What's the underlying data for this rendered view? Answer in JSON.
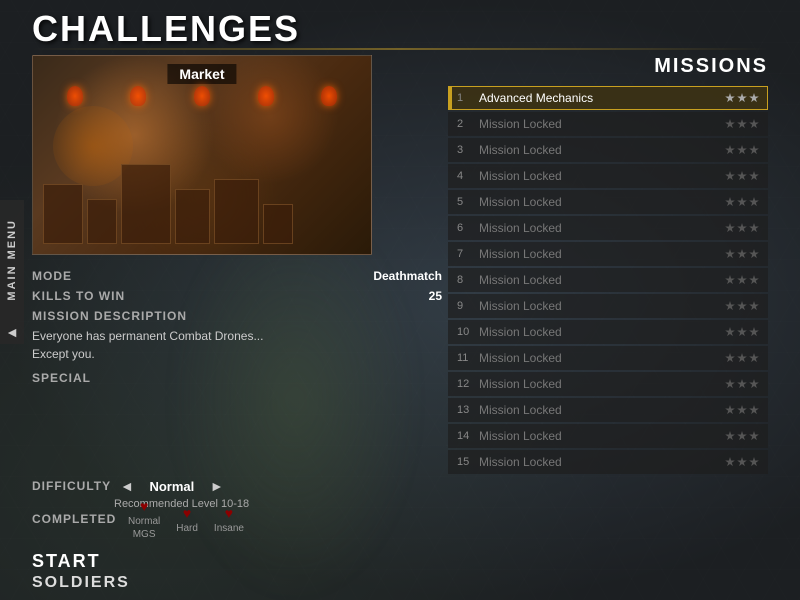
{
  "page": {
    "title": "CHALLENGES"
  },
  "side_menu": {
    "label": "MAIN MENU",
    "arrow": "◄"
  },
  "map": {
    "name": "Market"
  },
  "mission_info": {
    "mode_label": "MODE",
    "mode_value": "Deathmatch",
    "kills_label": "KILLS TO WIN",
    "kills_value": "25",
    "desc_label": "MISSION DESCRIPTION",
    "desc_text": "Everyone has permanent Combat Drones...\nExcept you.",
    "special_label": "SPECIAL"
  },
  "difficulty": {
    "label": "DIFFICULTY",
    "value": "Normal",
    "recommended": "Recommended Level 10-18",
    "left_arrow": "◄",
    "right_arrow": "►"
  },
  "completed": {
    "label": "COMPLETED",
    "items": [
      {
        "icon": "♥",
        "diff": "Normal",
        "sub": "MGS"
      },
      {
        "icon": "♥",
        "diff": "Hard",
        "sub": ""
      },
      {
        "icon": "♥",
        "diff": "Insane",
        "sub": ""
      }
    ]
  },
  "actions": {
    "start": "START",
    "soldiers": "SOLDIERS"
  },
  "missions": {
    "title": "MISSIONS",
    "list": [
      {
        "num": "1",
        "name": "Advanced Mechanics",
        "active": true,
        "stars": [
          true,
          true,
          true
        ]
      },
      {
        "num": "2",
        "name": "Mission Locked",
        "active": false,
        "stars": [
          false,
          false,
          false
        ]
      },
      {
        "num": "3",
        "name": "Mission Locked",
        "active": false,
        "stars": [
          false,
          false,
          false
        ]
      },
      {
        "num": "4",
        "name": "Mission Locked",
        "active": false,
        "stars": [
          false,
          false,
          false
        ]
      },
      {
        "num": "5",
        "name": "Mission Locked",
        "active": false,
        "stars": [
          false,
          false,
          false
        ]
      },
      {
        "num": "6",
        "name": "Mission Locked",
        "active": false,
        "stars": [
          false,
          false,
          false
        ]
      },
      {
        "num": "7",
        "name": "Mission Locked",
        "active": false,
        "stars": [
          false,
          false,
          false
        ]
      },
      {
        "num": "8",
        "name": "Mission Locked",
        "active": false,
        "stars": [
          false,
          false,
          false
        ]
      },
      {
        "num": "9",
        "name": "Mission Locked",
        "active": false,
        "stars": [
          false,
          false,
          false
        ]
      },
      {
        "num": "10",
        "name": "Mission Locked",
        "active": false,
        "stars": [
          false,
          false,
          false
        ]
      },
      {
        "num": "11",
        "name": "Mission Locked",
        "active": false,
        "stars": [
          false,
          false,
          false
        ]
      },
      {
        "num": "12",
        "name": "Mission Locked",
        "active": false,
        "stars": [
          false,
          false,
          false
        ]
      },
      {
        "num": "13",
        "name": "Mission Locked",
        "active": false,
        "stars": [
          false,
          false,
          false
        ]
      },
      {
        "num": "14",
        "name": "Mission Locked",
        "active": false,
        "stars": [
          false,
          false,
          false
        ]
      },
      {
        "num": "15",
        "name": "Mission Locked",
        "active": false,
        "stars": [
          false,
          false,
          false
        ]
      }
    ]
  }
}
